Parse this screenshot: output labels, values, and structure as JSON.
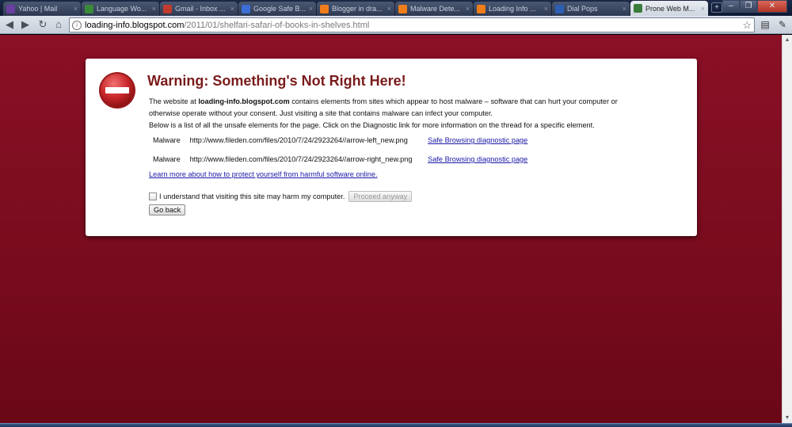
{
  "browser": {
    "tabs": [
      {
        "label": "Yahoo | Mail",
        "favicon_color": "#6b3fa0",
        "active": false
      },
      {
        "label": "Language Wo...",
        "favicon_color": "#3a8a3a",
        "active": false
      },
      {
        "label": "Gmail - Inbox ...",
        "favicon_color": "#c23b2e",
        "active": false
      },
      {
        "label": "Google Safe B...",
        "favicon_color": "#3b6fd6",
        "active": false
      },
      {
        "label": "Blogger in dra...",
        "favicon_color": "#f07d1a",
        "active": false
      },
      {
        "label": "Malware Dete...",
        "favicon_color": "#f07d1a",
        "active": false
      },
      {
        "label": "Loading Info ...",
        "favicon_color": "#f07d1a",
        "active": false
      },
      {
        "label": "Dial Pops",
        "favicon_color": "#2d5fb5",
        "active": false
      },
      {
        "label": "Prone Web M...",
        "favicon_color": "#3a7d3a",
        "active": true
      }
    ],
    "url_host": "loading-info.blogspot.com",
    "url_path": "/2011/01/shelfari-safari-of-books-in-shelves.html"
  },
  "warning": {
    "title": "Warning: Something's Not Right Here!",
    "intro_prefix": "The website at ",
    "site": "loading-info.blogspot.com",
    "intro_suffix": " contains elements from sites which appear to host malware – software that can hurt your computer or otherwise operate without your consent. Just visiting a site that contains malware can infect your computer.",
    "list_intro": "Below is a list of all the unsafe elements for the page. Click on the Diagnostic link for more information on the thread for a specific element.",
    "elements": [
      {
        "type": "Malware",
        "url": "http://www.fileden.com/files/2010/7/24/2923264//arrow-left_new.png",
        "link": "Safe Browsing diagnostic page"
      },
      {
        "type": "Malware",
        "url": "http://www.fileden.com/files/2010/7/24/2923264//arrow-right_new.png",
        "link": "Safe Browsing diagnostic page"
      }
    ],
    "learn_more": "Learn more about how to protect yourself from harmful software online.",
    "consent_label": "I understand that visiting this site may harm my computer.",
    "proceed_label": "Proceed anyway",
    "goback_label": "Go back"
  },
  "colors": {
    "page_background": "#7e0d20",
    "title": "#7a1b1b",
    "link": "#1a1aa8",
    "stop_icon": "#c8262a"
  }
}
